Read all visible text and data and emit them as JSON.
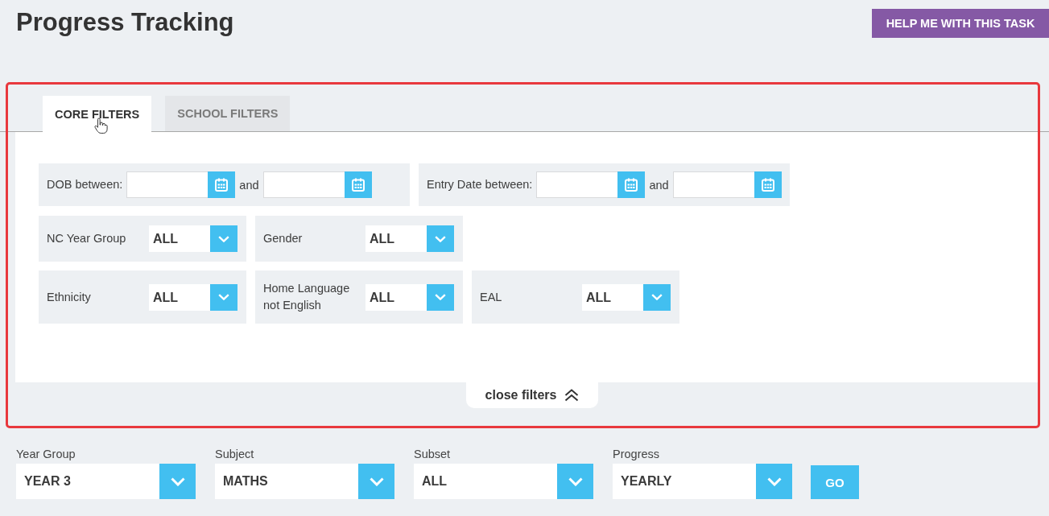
{
  "page": {
    "title": "Progress Tracking",
    "help_button": "HELP ME WITH THIS TASK"
  },
  "filter_panel": {
    "tabs": [
      {
        "label": "CORE FILTERS",
        "selected": true
      },
      {
        "label": "SCHOOL FILTERS",
        "selected": false
      }
    ],
    "date_filters": [
      {
        "label": "DOB between:",
        "joiner": "and"
      },
      {
        "label": "Entry Date between:",
        "joiner": "and"
      }
    ],
    "select_rows": [
      {
        "filters": [
          {
            "label": "NC Year Group",
            "value": "ALL"
          },
          {
            "label": "Gender",
            "value": "ALL"
          }
        ]
      },
      {
        "filters": [
          {
            "label": "Ethnicity",
            "value": "ALL"
          },
          {
            "label": "Home Language not English",
            "value": "ALL"
          },
          {
            "label": "EAL",
            "value": "ALL"
          }
        ]
      }
    ],
    "close_button": "close filters"
  },
  "selectors": [
    {
      "label": "Year Group",
      "value": "YEAR 3"
    },
    {
      "label": "Subject",
      "value": "MATHS"
    },
    {
      "label": "Subset",
      "value": "ALL"
    },
    {
      "label": "Progress",
      "value": "YEARLY"
    }
  ],
  "go_button": "GO"
}
